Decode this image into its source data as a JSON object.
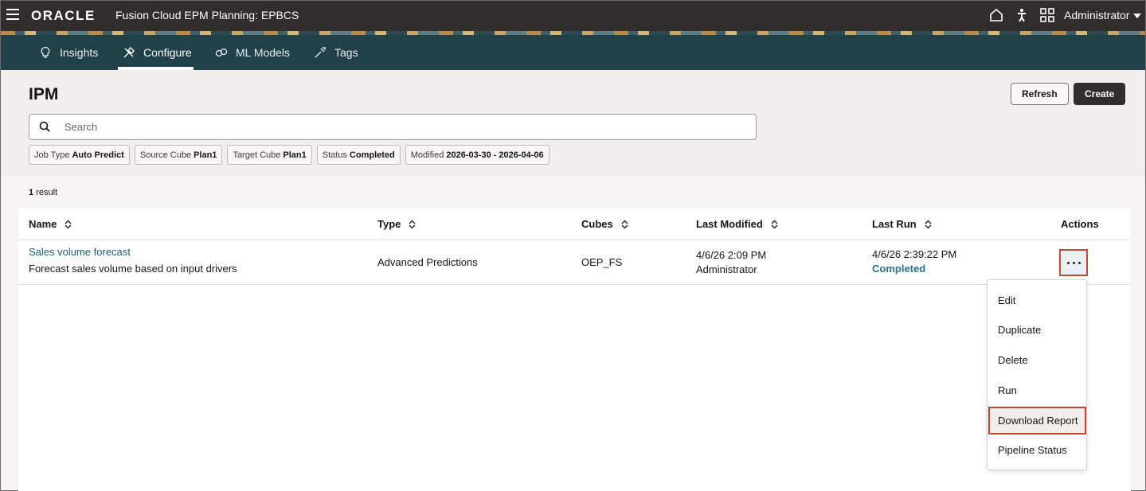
{
  "header": {
    "logo": "ORACLE",
    "app_title": "Fusion Cloud EPM Planning:  EPBCS",
    "user": "Administrator",
    "icons": [
      "home-icon",
      "accessibility-icon",
      "apps-grid-icon"
    ]
  },
  "nav": {
    "tabs": [
      {
        "label": "Insights",
        "icon": "lightbulb-icon",
        "active": false
      },
      {
        "label": "Configure",
        "icon": "tools-icon",
        "active": true
      },
      {
        "label": "ML Models",
        "icon": "ml-models-icon",
        "active": false
      },
      {
        "label": "Tags",
        "icon": "tags-icon",
        "active": false
      }
    ]
  },
  "page": {
    "title": "IPM",
    "refresh_label": "Refresh",
    "create_label": "Create",
    "search_placeholder": "Search"
  },
  "filters": [
    {
      "name": "Job Type",
      "value": "Auto Predict"
    },
    {
      "name": "Source Cube",
      "value": "Plan1"
    },
    {
      "name": "Target Cube",
      "value": "Plan1"
    },
    {
      "name": "Status",
      "value": "Completed"
    },
    {
      "name": "Modified",
      "value": "2026-03-30 - 2026-04-06"
    }
  ],
  "results": {
    "count": "1",
    "label": " result"
  },
  "table": {
    "columns": [
      "Name",
      "Type",
      "Cubes",
      "Last Modified",
      "Last Run",
      "Actions"
    ],
    "rows": [
      {
        "name": "Sales volume forecast",
        "description": "Forecast sales volume based on input drivers",
        "type": "Advanced Predictions",
        "cubes": "OEP_FS",
        "modified_date": "4/6/26 2:09 PM",
        "modified_by": "Administrator",
        "run_date": "4/6/26 2:39:22 PM",
        "run_status": "Completed"
      }
    ]
  },
  "menu": {
    "items": [
      "Edit",
      "Duplicate",
      "Delete",
      "Run",
      "Download Report",
      "Pipeline Status"
    ]
  },
  "colors": {
    "header_bg": "#312d2a",
    "nav_bg": "#214148",
    "highlight": "#c74634",
    "link": "#1f5b7a"
  }
}
